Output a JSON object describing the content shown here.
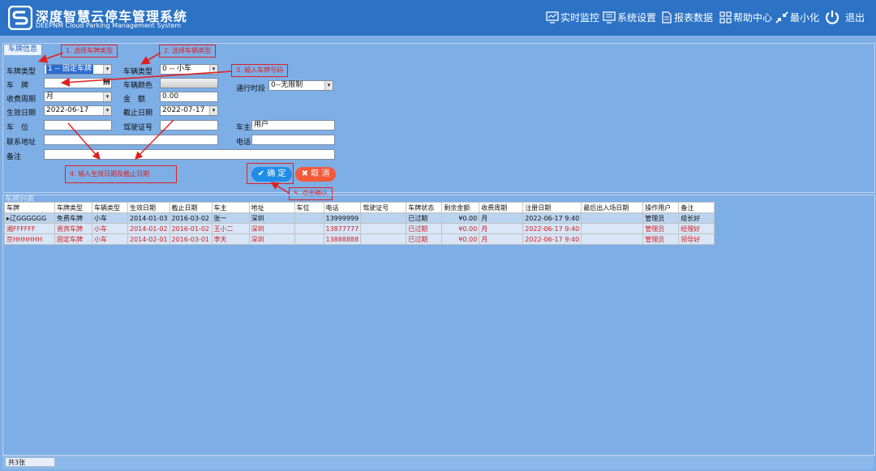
{
  "app": {
    "title": "深度智慧云停车管理系统",
    "subtitle": "DEEPNM Cloud Parking Management System"
  },
  "nav": [
    {
      "label": "实时监控",
      "icon": "monitor-icon"
    },
    {
      "label": "系统设置",
      "icon": "settings-screen-icon"
    },
    {
      "label": "报表数据",
      "icon": "report-icon"
    },
    {
      "label": "帮助中心",
      "icon": "grid-icon"
    },
    {
      "label": "最小化",
      "icon": "minimize-icon"
    },
    {
      "label": "退出",
      "icon": "power-icon"
    }
  ],
  "form": {
    "tab": "车牌信息",
    "plate_type_label": "车牌类型",
    "plate_type_value": "1 -- 固定车牌",
    "plate_label": "车　牌",
    "plate_value": "",
    "plate_suffix": "辨",
    "pay_period_label": "收费周期",
    "pay_period_value": "月",
    "start_date_label": "生效日期",
    "start_date_value": "2022-06-17",
    "space_label": "车　位",
    "space_value": "",
    "address_label": "联系地址",
    "address_value": "",
    "remark_label": "备注",
    "remark_value": "",
    "vehicle_type_label": "车辆类型",
    "vehicle_type_value": "0 -- 小车",
    "vehicle_color_label": "车辆颜色",
    "amount_label": "金　额",
    "amount_value": "0.00",
    "end_date_label": "截止日期",
    "end_date_value": "2022-07-17",
    "license_label": "驾驶证号",
    "license_value": "",
    "pass_time_label": "通行时段",
    "pass_time_value": "0--无限制",
    "owner_label": "车主",
    "owner_value": "用户",
    "phone_label": "电话",
    "phone_value": "",
    "confirm_button": "确 定",
    "cancel_button": "取 消"
  },
  "annotations": [
    "1. 选择车牌类型",
    "2. 选择车辆类型",
    "3. 输入车牌号码",
    "4. 输入生效日期及截止日期",
    "5. 点击确认"
  ],
  "list": {
    "title": "车牌列表",
    "columns": [
      "车牌",
      "车牌类型",
      "车辆类型",
      "生效日期",
      "截止日期",
      "车主",
      "地址",
      "车位",
      "电话",
      "驾驶证号",
      "车牌状态",
      "剩余金额",
      "收费周期",
      "注册日期",
      "最后出入场日期",
      "操作用户",
      "备注"
    ],
    "rows": [
      [
        "辽GGGGGG",
        "免费车牌",
        "小车",
        "2014-01-03",
        "2016-03-02",
        "张一",
        "深圳",
        "",
        "13999999",
        "",
        "已过期",
        "¥0.00",
        "月",
        "2022-06-17 9:40",
        "",
        "管理员",
        "组长好"
      ],
      [
        "湘FFFFFF",
        "贵宾车牌",
        "小车",
        "2014-01-02",
        "2016-01-02",
        "王小二",
        "深圳",
        "",
        "13877777",
        "",
        "已过期",
        "¥0.00",
        "月",
        "2022-06-17 9:40",
        "",
        "管理员",
        "经理好"
      ],
      [
        "京HHHHHH",
        "固定车牌",
        "小车",
        "2014-02-01",
        "2016-03-01",
        "李天",
        "深圳",
        "",
        "13888888",
        "",
        "已过期",
        "¥0.00",
        "月",
        "2022-06-17 9:40",
        "",
        "管理员",
        "领导好"
      ]
    ]
  },
  "status": {
    "count": "共3张"
  },
  "colors": {
    "header": "#2c73c6",
    "background": "#7eaee6",
    "annotation": "#e02020",
    "confirm": "#1f8de8",
    "cancel": "#f45a3a"
  }
}
